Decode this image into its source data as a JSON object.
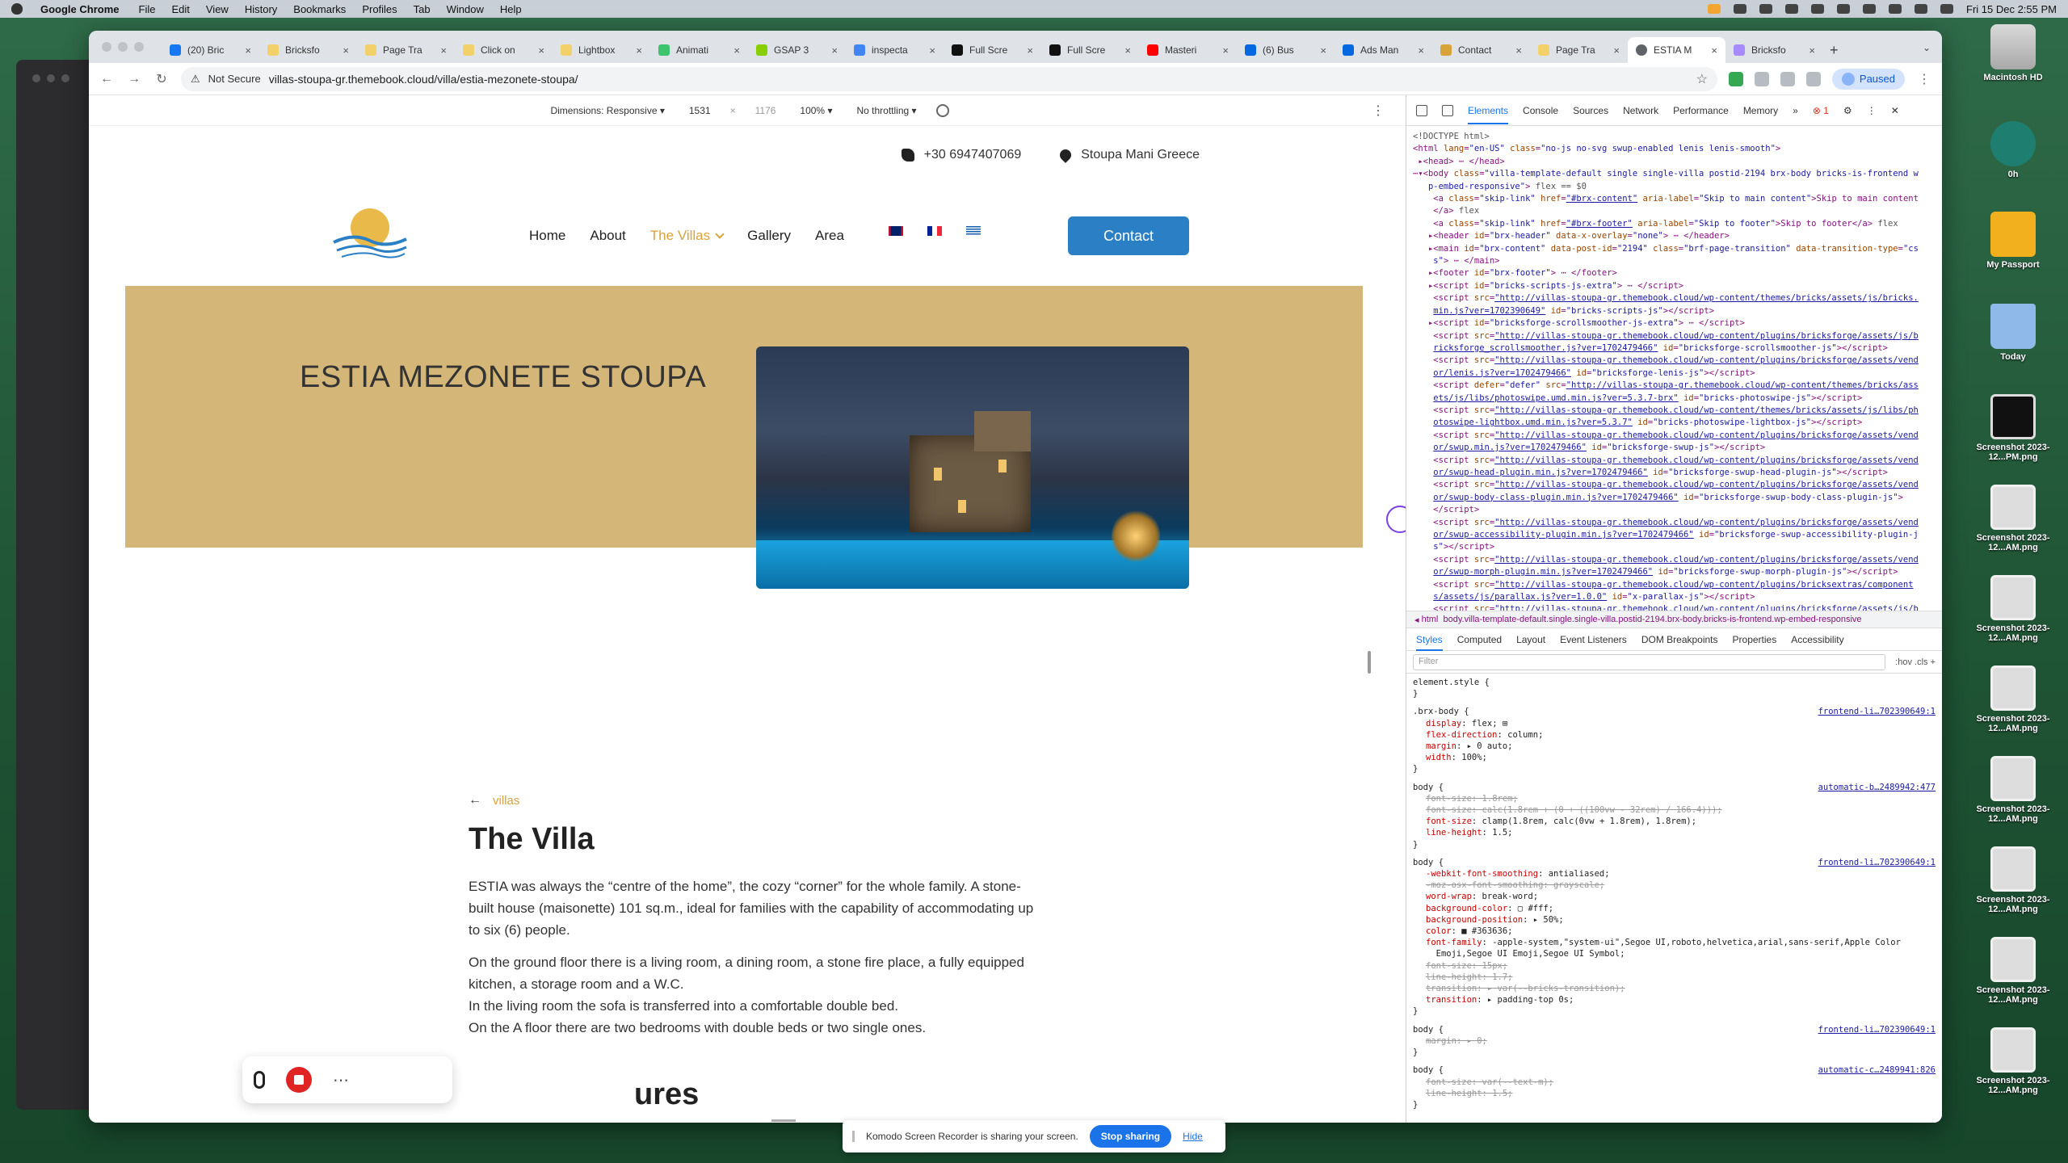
{
  "menubar": {
    "app": "Google Chrome",
    "items": [
      "File",
      "Edit",
      "View",
      "History",
      "Bookmarks",
      "Profiles",
      "Tab",
      "Window",
      "Help"
    ],
    "clock": "Fri 15 Dec  2:55 PM"
  },
  "chrome": {
    "tabs": [
      {
        "label": "(20) Bric"
      },
      {
        "label": "Bricksfo"
      },
      {
        "label": "Page Tra"
      },
      {
        "label": "Click on"
      },
      {
        "label": "Lightbox"
      },
      {
        "label": "Animati"
      },
      {
        "label": "GSAP 3"
      },
      {
        "label": "inspecta"
      },
      {
        "label": "Full Scre"
      },
      {
        "label": "Full Scre"
      },
      {
        "label": "Masteri"
      },
      {
        "label": "(6) Bus"
      },
      {
        "label": "Ads Man"
      },
      {
        "label": "Contact"
      },
      {
        "label": "Page Tra"
      },
      {
        "label": "ESTIA M",
        "active": true
      },
      {
        "label": "Bricksfo"
      }
    ],
    "not_secure": "Not Secure",
    "url": "villas-stoupa-gr.themebook.cloud/villa/estia-mezonete-stoupa/",
    "paused": "Paused"
  },
  "devbar": {
    "dimensions": "Dimensions: Responsive",
    "width": "1531",
    "height": "1176",
    "zoom": "100%",
    "throttle": "No throttling"
  },
  "site": {
    "phone": "+30 6947407069",
    "location": "Stoupa Mani Greece",
    "nav": [
      "Home",
      "About",
      "The Villas",
      "Gallery",
      "Area"
    ],
    "contact": "Contact",
    "hero_title": "ESTIA MEZONETE STOUPA",
    "back_link": "villas",
    "section_title": "The Villa",
    "para1": "ESTIA was always the “centre of the home”, the cozy “corner” for the whole family. A stone-built house (maisonette) 101 sq.m., ideal for families with the capability of accommodating up to six (6) people.",
    "para2_l1": "On the ground floor there is a living room, a dining room, a stone fire place, a fully equipped kitchen, a storage room and a W.C.",
    "para2_l2": "In the living room the sofa is transferred into a comfortable double bed.",
    "para2_l3": "On the A floor there are two bedrooms with double beds or two single ones.",
    "features": "ures"
  },
  "devtools": {
    "tabs": [
      "Elements",
      "Console",
      "Sources",
      "Network",
      "Performance",
      "Memory"
    ],
    "error_count": "1",
    "breadcrumb": "body.villa-template-default.single.single-villa.postid-2194.brx-body.bricks-is-frontend.wp-embed-responsive",
    "subtabs": [
      "Styles",
      "Computed",
      "Layout",
      "Event Listeners",
      "DOM Breakpoints",
      "Properties",
      "Accessibility"
    ],
    "filter_placeholder": "Filter",
    "filter_tools": ":hov  .cls  +"
  },
  "desktop_icons": [
    {
      "label": "Macintosh HD"
    },
    {
      "label": "0h"
    },
    {
      "label": "My Passport"
    },
    {
      "label": "Today"
    },
    {
      "label": "Screenshot 2023-12...PM.png"
    },
    {
      "label": "Screenshot 2023-12...AM.png"
    },
    {
      "label": "Screenshot 2023-12...AM.png"
    },
    {
      "label": "Screenshot 2023-12...AM.png"
    },
    {
      "label": "Screenshot 2023-12...AM.png"
    },
    {
      "label": "Screenshot 2023-12...AM.png"
    },
    {
      "label": "Screenshot 2023-12...AM.png"
    },
    {
      "label": "Screenshot 2023-12...AM.png"
    }
  ],
  "share_banner": {
    "text": "Komodo Screen Recorder is sharing your screen.",
    "stop": "Stop sharing",
    "hide": "Hide"
  }
}
